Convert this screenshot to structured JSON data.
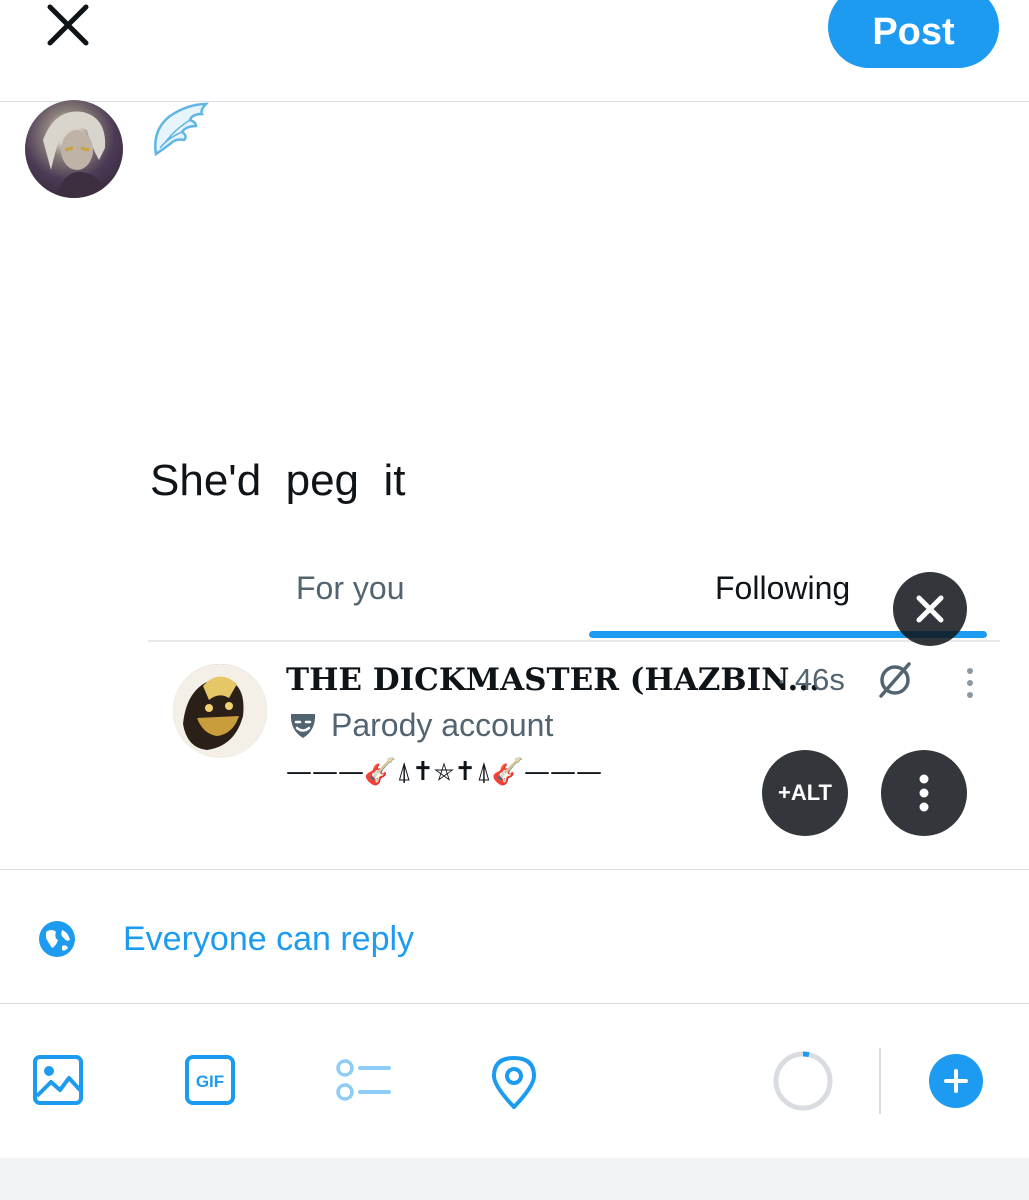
{
  "header": {
    "post_label": "Post",
    "close_icon": "close-icon"
  },
  "composer": {
    "avatar": "user-avatar",
    "emoji": "wing-emoji",
    "text": "She'd  peg  it"
  },
  "quoted_media": {
    "tabs": [
      {
        "label": "For you"
      },
      {
        "label": "Following"
      }
    ],
    "account": {
      "name": "THE DICKMASTER (HAZBIN...",
      "time": "· 46s",
      "label": "Parody account",
      "bio": "———🎸⍋✝⛤✝⍋🎸———"
    },
    "alt_label": "+ALT"
  },
  "reply_settings": {
    "label": "Everyone can reply"
  },
  "toolbar": {
    "icons": [
      "image-icon",
      "gif-icon",
      "poll-icon",
      "location-icon"
    ],
    "gif_label": "GIF"
  },
  "colors": {
    "accent": "#1d9bf0",
    "text": "#0f1419",
    "secondary": "#536471"
  }
}
